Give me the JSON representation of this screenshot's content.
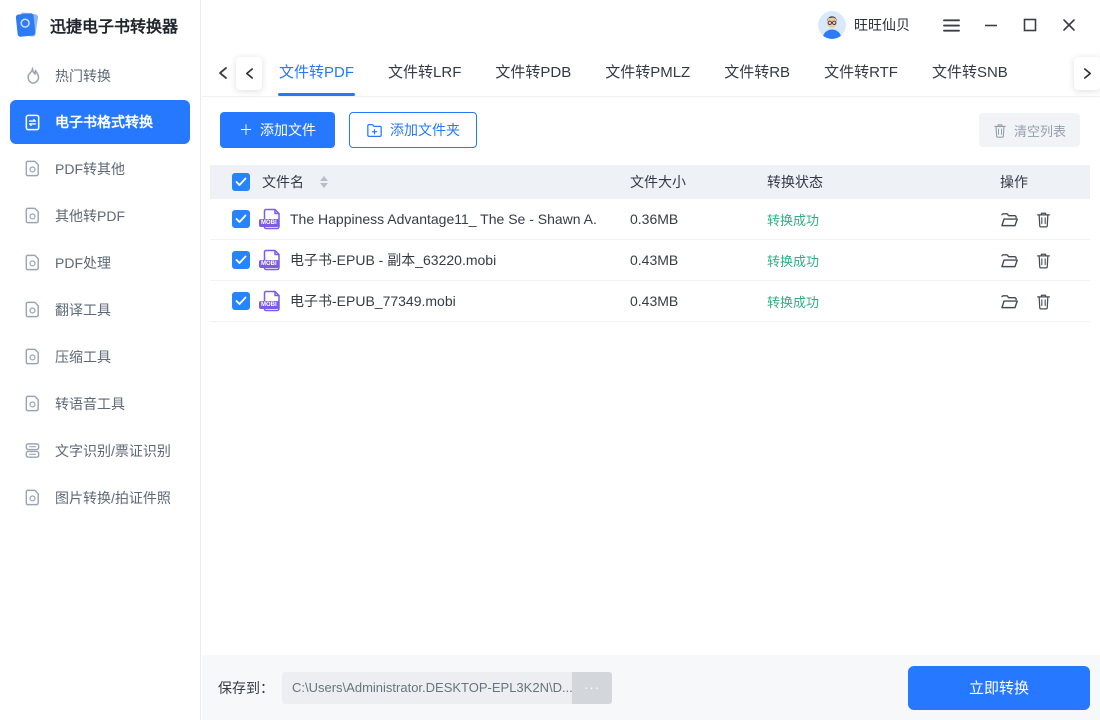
{
  "window": {
    "title": "迅捷电子书转换器",
    "user_name": "旺旺仙贝"
  },
  "sidebar": {
    "items": [
      {
        "label": "热门转换",
        "icon": "flame-icon",
        "active": false
      },
      {
        "label": "电子书格式转换",
        "icon": "ebook-convert-icon",
        "active": true
      },
      {
        "label": "PDF转其他",
        "icon": "pdf-to-other-icon",
        "active": false
      },
      {
        "label": "其他转PDF",
        "icon": "other-to-pdf-icon",
        "active": false
      },
      {
        "label": "PDF处理",
        "icon": "pdf-edit-icon",
        "active": false
      },
      {
        "label": "翻译工具",
        "icon": "translate-icon",
        "active": false
      },
      {
        "label": "压缩工具",
        "icon": "compress-icon",
        "active": false
      },
      {
        "label": "转语音工具",
        "icon": "audio-icon",
        "active": false
      },
      {
        "label": "文字识别/票证识别",
        "icon": "ocr-icon",
        "active": false
      },
      {
        "label": "图片转换/拍证件照",
        "icon": "image-photo-icon",
        "active": false
      }
    ]
  },
  "tabs": {
    "active_index": 0,
    "items": [
      {
        "label": "文件转PDF"
      },
      {
        "label": "文件转LRF"
      },
      {
        "label": "文件转PDB"
      },
      {
        "label": "文件转PMLZ"
      },
      {
        "label": "文件转RB"
      },
      {
        "label": "文件转RTF"
      },
      {
        "label": "文件转SNB"
      }
    ]
  },
  "toolbar": {
    "add_file": "添加文件",
    "add_folder": "添加文件夹",
    "clear_list": "清空列表"
  },
  "table": {
    "headers": {
      "name": "文件名",
      "size": "文件大小",
      "status": "转换状态",
      "actions": "操作"
    },
    "rows": [
      {
        "name": "The Happiness Advantage11_ The Se - Shawn A.",
        "type": "MOBI",
        "size": "0.36MB",
        "status": "转换成功",
        "checked": true
      },
      {
        "name": "电子书-EPUB - 副本_63220.mobi",
        "type": "MOBI",
        "size": "0.43MB",
        "status": "转换成功",
        "checked": true
      },
      {
        "name": "电子书-EPUB_77349.mobi",
        "type": "MOBI",
        "size": "0.43MB",
        "status": "转换成功",
        "checked": true
      }
    ]
  },
  "footer": {
    "save_label": "保存到：",
    "save_path": "C:\\Users\\Administrator.DESKTOP-EPL3K2N\\D...",
    "browse": "···",
    "convert": "立即转换"
  },
  "icons": {
    "logo": "app-logo-book",
    "menu": "hamburger-icon",
    "minimize": "minimize-icon",
    "maximize": "maximize-icon",
    "close": "close-icon",
    "file_type": "mobi-file-icon",
    "open": "folder-open-icon",
    "delete": "trash-icon"
  },
  "colors": {
    "accent_blue": "#2678FF",
    "status_green": "#2FAE81",
    "mobi_purple": "#7B5BE8",
    "table_header_bg": "#EEF1F5",
    "footer_bg": "#F7F8FA"
  }
}
